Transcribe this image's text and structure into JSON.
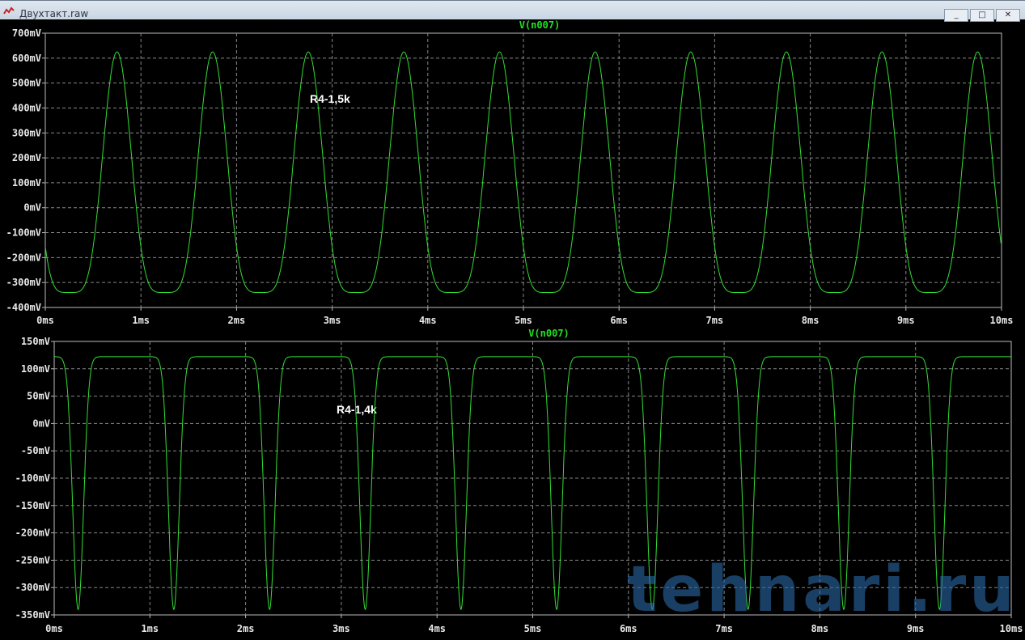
{
  "window": {
    "title": "Двухтакт.raw",
    "buttons": [
      "_",
      "□",
      "✕"
    ]
  },
  "watermark": "tehnari.ru",
  "chart_data": [
    {
      "type": "line",
      "title": "V(n007)",
      "annotation": "R4-1,5k",
      "xlim": [
        0,
        10
      ],
      "ylim": [
        -400,
        700
      ],
      "x_ticks": [
        "0ms",
        "1ms",
        "2ms",
        "3ms",
        "4ms",
        "5ms",
        "6ms",
        "7ms",
        "8ms",
        "9ms",
        "10ms"
      ],
      "y_ticks": [
        "700mV",
        "600mV",
        "500mV",
        "400mV",
        "300mV",
        "200mV",
        "100mV",
        "0mV",
        "-100mV",
        "-200mV",
        "-300mV",
        "-400mV"
      ],
      "y_tick_values": [
        700,
        600,
        500,
        400,
        300,
        200,
        100,
        0,
        -100,
        -200,
        -300,
        -400
      ],
      "grid": true,
      "series": [
        {
          "name": "V(n007)",
          "color": "#33dd33",
          "period_ms": 1,
          "peak_times_ms": [
            0.75,
            1.75,
            2.75,
            3.75,
            4.75,
            5.75,
            6.75,
            7.75,
            8.75,
            9.75
          ],
          "peak_mV": 625,
          "trough_mV": -340,
          "shape": "narrow peaks, flat troughs"
        }
      ]
    },
    {
      "type": "line",
      "title": "V(n007)",
      "annotation": "R4-1,4k",
      "xlim": [
        0,
        10
      ],
      "ylim": [
        -350,
        150
      ],
      "x_ticks": [
        "0ms",
        "1ms",
        "2ms",
        "3ms",
        "4ms",
        "5ms",
        "6ms",
        "7ms",
        "8ms",
        "9ms",
        "10ms"
      ],
      "y_ticks": [
        "150mV",
        "100mV",
        "50mV",
        "0mV",
        "-50mV",
        "-100mV",
        "-150mV",
        "-200mV",
        "-250mV",
        "-300mV",
        "-350mV"
      ],
      "y_tick_values": [
        150,
        100,
        50,
        0,
        -50,
        -100,
        -150,
        -200,
        -250,
        -300,
        -350
      ],
      "grid": true,
      "series": [
        {
          "name": "V(n007)",
          "color": "#33dd33",
          "period_ms": 1,
          "trough_times_ms": [
            0.25,
            1.25,
            2.25,
            3.25,
            4.25,
            5.25,
            6.25,
            7.25,
            8.25,
            9.25
          ],
          "peak_mV": 122,
          "trough_mV": -340,
          "shape": "broad peaks, narrow troughs"
        }
      ]
    }
  ]
}
